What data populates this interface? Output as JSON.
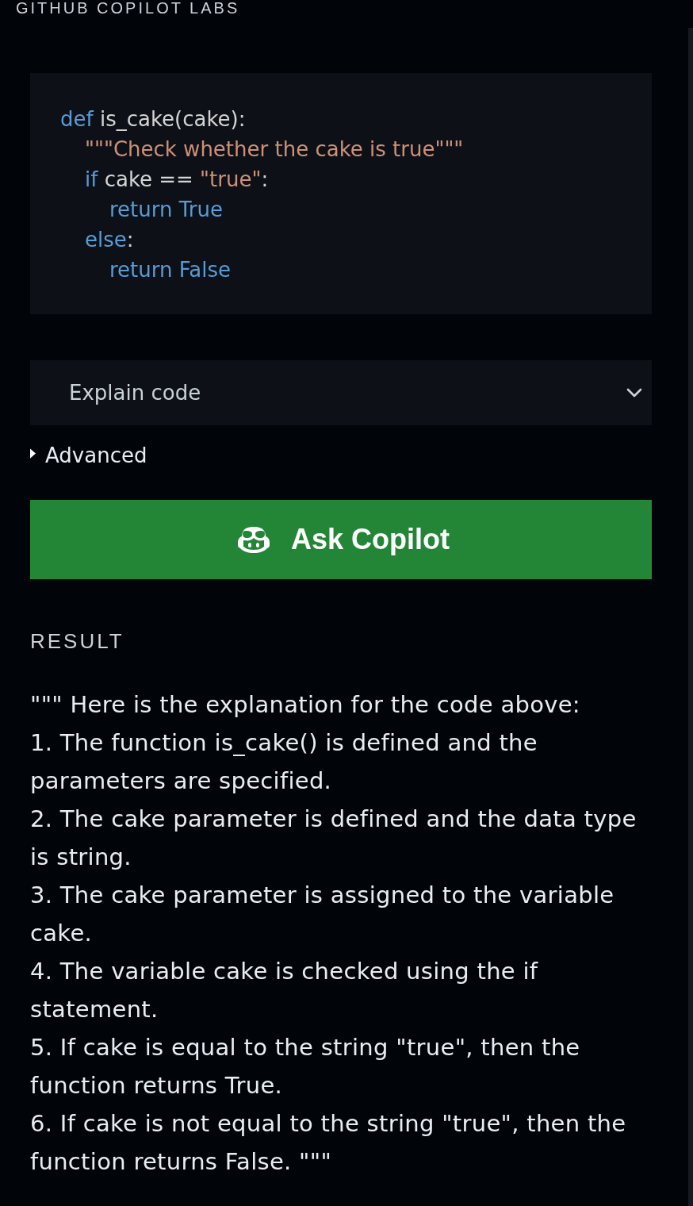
{
  "header": {
    "title": "GITHUB COPILOT LABS"
  },
  "code": {
    "lines": [
      {
        "tokens": [
          {
            "kind": "keyword",
            "text": "def"
          },
          {
            "kind": "plain",
            "text": " is_cake(cake):"
          }
        ],
        "children": [
          {
            "tokens": [
              {
                "kind": "string",
                "text": "\"\"\"Check whether the cake is true\"\"\""
              }
            ]
          },
          {
            "tokens": [
              {
                "kind": "keyword",
                "text": "if"
              },
              {
                "kind": "plain",
                "text": " cake == "
              },
              {
                "kind": "string",
                "text": "\"true\""
              },
              {
                "kind": "plain",
                "text": ":"
              }
            ],
            "children": [
              {
                "tokens": [
                  {
                    "kind": "keyword",
                    "text": "return True"
                  }
                ]
              }
            ]
          },
          {
            "tokens": [
              {
                "kind": "keyword",
                "text": "else"
              },
              {
                "kind": "plain",
                "text": ":"
              }
            ],
            "children": [
              {
                "tokens": [
                  {
                    "kind": "keyword",
                    "text": "return False"
                  }
                ]
              }
            ]
          }
        ]
      }
    ]
  },
  "task_select": {
    "value": "Explain code"
  },
  "advanced": {
    "label": "Advanced",
    "expanded": false
  },
  "ask_button": {
    "label": "Ask Copilot"
  },
  "result": {
    "label": "RESULT",
    "paragraphs": [
      "\"\"\" Here is the explanation for the code above:",
      "1. The function is_cake() is defined and the parameters are specified.",
      "2. The cake parameter is defined and the data type is string.",
      "3. The cake parameter is assigned to the variable cake.",
      "4. The variable cake is checked using the if statement.",
      "5. If cake is equal to the string \"true\", then the function returns True.",
      "6. If cake is not equal to the string \"true\", then the function returns False. \"\"\""
    ]
  }
}
